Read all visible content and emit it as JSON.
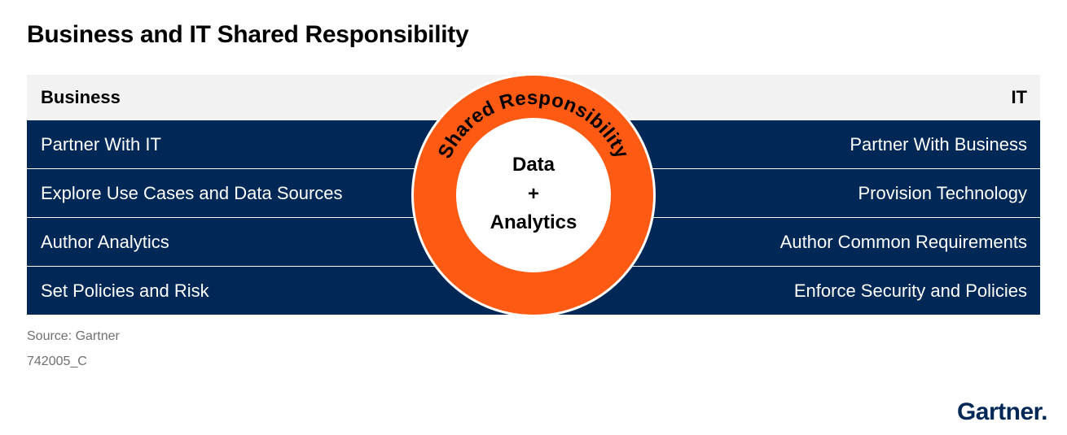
{
  "title": "Business and IT Shared Responsibility",
  "header": {
    "left": "Business",
    "right": "IT"
  },
  "rows": [
    {
      "left": "Partner With IT",
      "right": "Partner With Business"
    },
    {
      "left": "Explore Use Cases and Data Sources",
      "right": "Provision Technology"
    },
    {
      "left": "Author Analytics",
      "right": "Author Common Requirements"
    },
    {
      "left": "Set Policies and Risk",
      "right": "Enforce Security and Policies"
    }
  ],
  "center": {
    "ring_label": "Shared Responsibility",
    "line1": "Data",
    "line2": "+",
    "line3": "Analytics"
  },
  "footer": {
    "source": "Source: Gartner",
    "code": "742005_C"
  },
  "logo": {
    "text": "Gartner",
    "dot": "."
  },
  "colors": {
    "navy": "#002856",
    "orange": "#ff5a14",
    "header_band": "#f2f2f2",
    "divider": "#ffffff"
  }
}
